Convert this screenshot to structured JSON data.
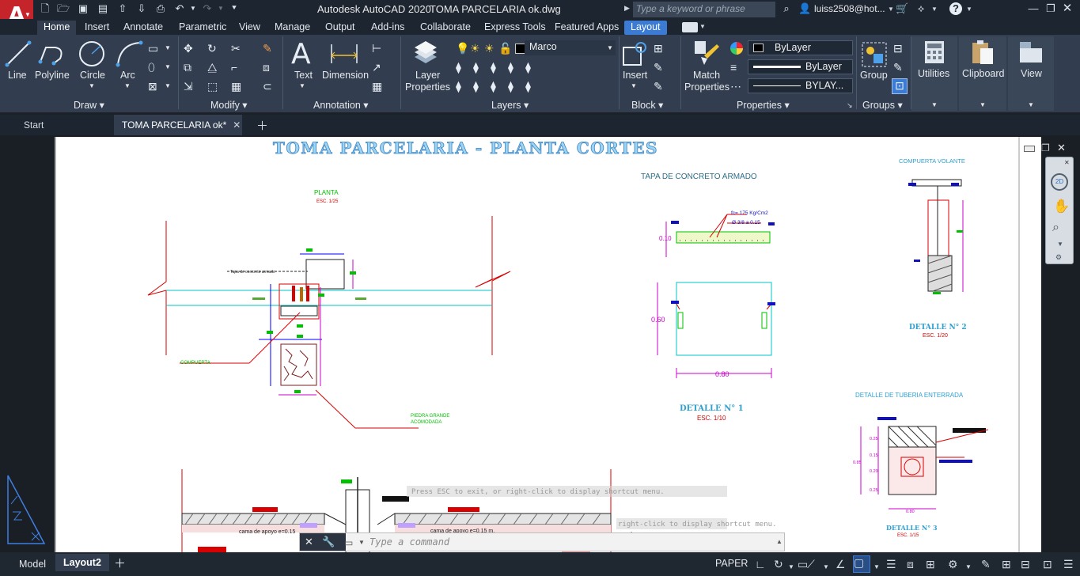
{
  "app": {
    "title": "Autodesk AutoCAD 2020",
    "file": "TOMA PARCELARIA ok.dwg",
    "search_placeholder": "Type a keyword or phrase",
    "user": "luiss2508@hot...",
    "logo": "A"
  },
  "ribbon_tabs": [
    "Home",
    "Insert",
    "Annotate",
    "Parametric",
    "View",
    "Manage",
    "Output",
    "Add-ins",
    "Collaborate",
    "Express Tools",
    "Featured Apps",
    "Layout"
  ],
  "panels": {
    "draw": {
      "name": "Draw",
      "tools": [
        "Line",
        "Polyline",
        "Circle",
        "Arc"
      ]
    },
    "modify": {
      "name": "Modify"
    },
    "annotation": {
      "name": "Annotation",
      "tools": [
        "Text",
        "Dimension"
      ]
    },
    "layers": {
      "name": "Layers",
      "tool": "Layer Properties",
      "current": "Marco"
    },
    "block": {
      "name": "Block",
      "tool": "Insert"
    },
    "properties": {
      "name": "Properties",
      "tool": "Match Properties",
      "color": "ByLayer",
      "linetype": "ByLayer",
      "lineweight": "BYLAY..."
    },
    "groups": {
      "name": "Groups",
      "tool": "Group"
    },
    "utilities": "Utilities",
    "clipboard": "Clipboard",
    "view": "View"
  },
  "doc_tabs": {
    "start": "Start",
    "active": "TOMA PARCELARIA ok*"
  },
  "drawing": {
    "main_title": "TOMA PARCELARIA - PLANTA CORTES",
    "planta": "PLANTA",
    "planta_scale": "ESC. 1/25",
    "tapa_label": "Tapa de concreto armado",
    "compuerta": "COMPUERTA",
    "piedra_1": "PIEDRA GRANDE",
    "piedra_2": "ACOMODADA",
    "tapa_title": "TAPA DE CONCRETO ARMADO",
    "fc": "fc= 175 Kg/Cm2",
    "rebar": "Ø 3/8 a 0.15",
    "dim_010": "0.10",
    "dim_060": "0.60",
    "dim_080": "0.80",
    "detalle1": "DETALLE N° 1",
    "detalle1_scale": "ESC. 1/10",
    "compuerta_volante": "COMPUERTA VOLANTE",
    "detalle2": "DETALLE N° 2",
    "detalle2_scale": "ESC. 1/20",
    "tuberia_title": "DETALLE DE TUBERIA ENTERRADA",
    "tub_dims": [
      "0.25",
      "0.15",
      "0.20",
      "0.25"
    ],
    "tub_total": "0.85",
    "tub_width": "0.80",
    "detalle3": "DETALLE N° 3",
    "detalle3_scale": "ESC. 1/15",
    "cama1": "cama de apoyo e=0.15",
    "cama2": "cama de apoyo e=0.15 m.",
    "ghost1": "Press ESC to exit, or right-click to display shortcut menu.",
    "ghost2": "right-click to display shortcut menu."
  },
  "command_placeholder": "Type a command",
  "layout_tabs": [
    "Model",
    "Layout2"
  ],
  "status": {
    "space": "PAPER"
  },
  "colors": {
    "accent": "#3c7bd4",
    "logo": "#c6242b",
    "ribbon": "#323e4f",
    "title_cyan": "#7fc7e8"
  }
}
